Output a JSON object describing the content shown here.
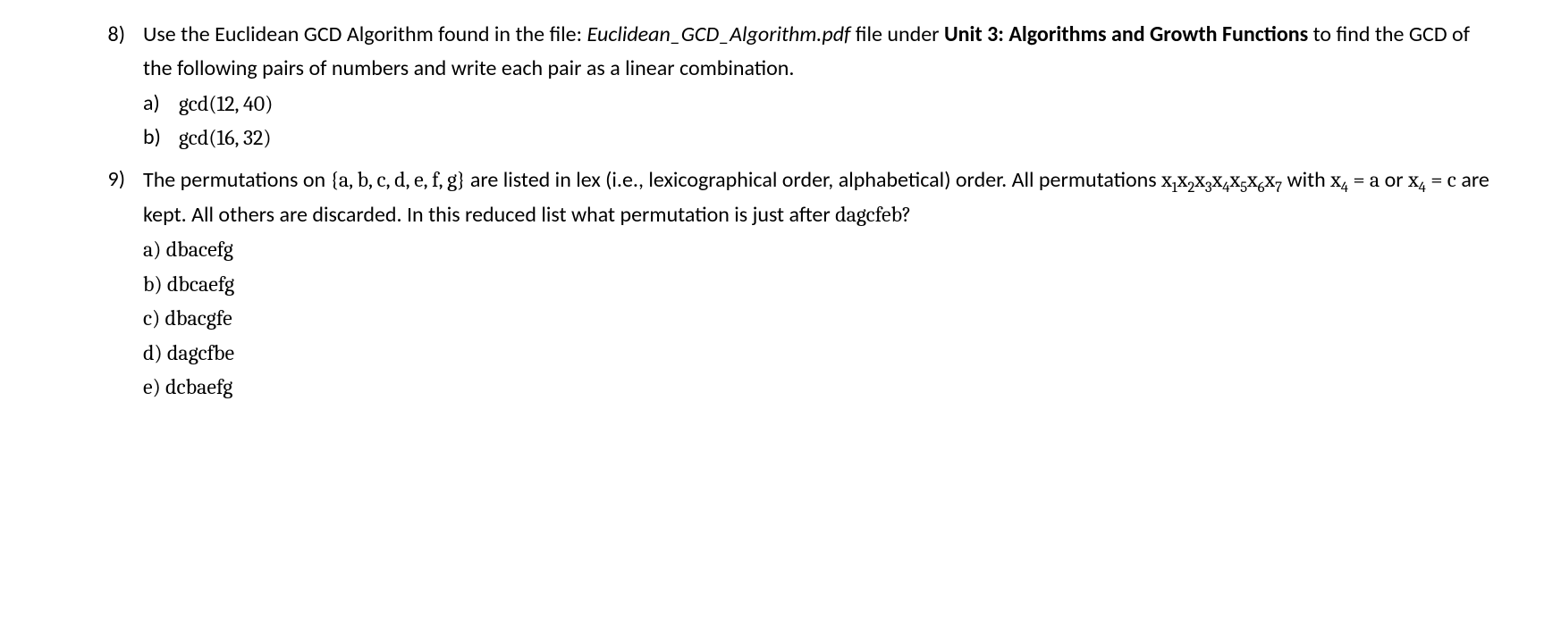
{
  "q8": {
    "number": "8)",
    "text_part1": "Use the Euclidean GCD Algorithm found in the file: ",
    "text_italic_file": "Euclidean_GCD_Algorithm.pdf",
    "text_part2": " file under ",
    "text_bold_unit": "Unit 3: Algorithms and Growth Functions",
    "text_part3": " to find the GCD of the following pairs of numbers and write each pair as a linear combination.",
    "sub_a_label": "a)",
    "sub_a_text": "gcd(12, 40)",
    "sub_b_label": "b)",
    "sub_b_text": "gcd(16, 32)"
  },
  "q9": {
    "number": "9)",
    "text_part1": "The permutations on ",
    "text_set": "{a, b, c, d, e, f, g}",
    "text_part2": " are listed in lex (i.e., lexicographical order, alphabetical) order. All permutations ",
    "x_var": "x",
    "sub1": "1",
    "sub2": "2",
    "sub3": "3",
    "sub4": "4",
    "sub5": "5",
    "sub6": "6",
    "sub7": "7",
    "text_part3": " with ",
    "cond1_a": "x",
    "cond1_s": "4",
    "cond1_eq": " = a",
    "text_or": " or ",
    "cond2_a": "x",
    "cond2_s": "4",
    "cond2_eq": " = c",
    "text_part4": " are kept. All others are discarded. In this reduced list what permutation is just after ",
    "text_target": "dagcfeb?",
    "opt_a": "a) dbacefg",
    "opt_b": "b) dbcaefg",
    "opt_c": "c) dbacgfe",
    "opt_d": "d) dagcfbe",
    "opt_e": "e) dcbaefg"
  }
}
